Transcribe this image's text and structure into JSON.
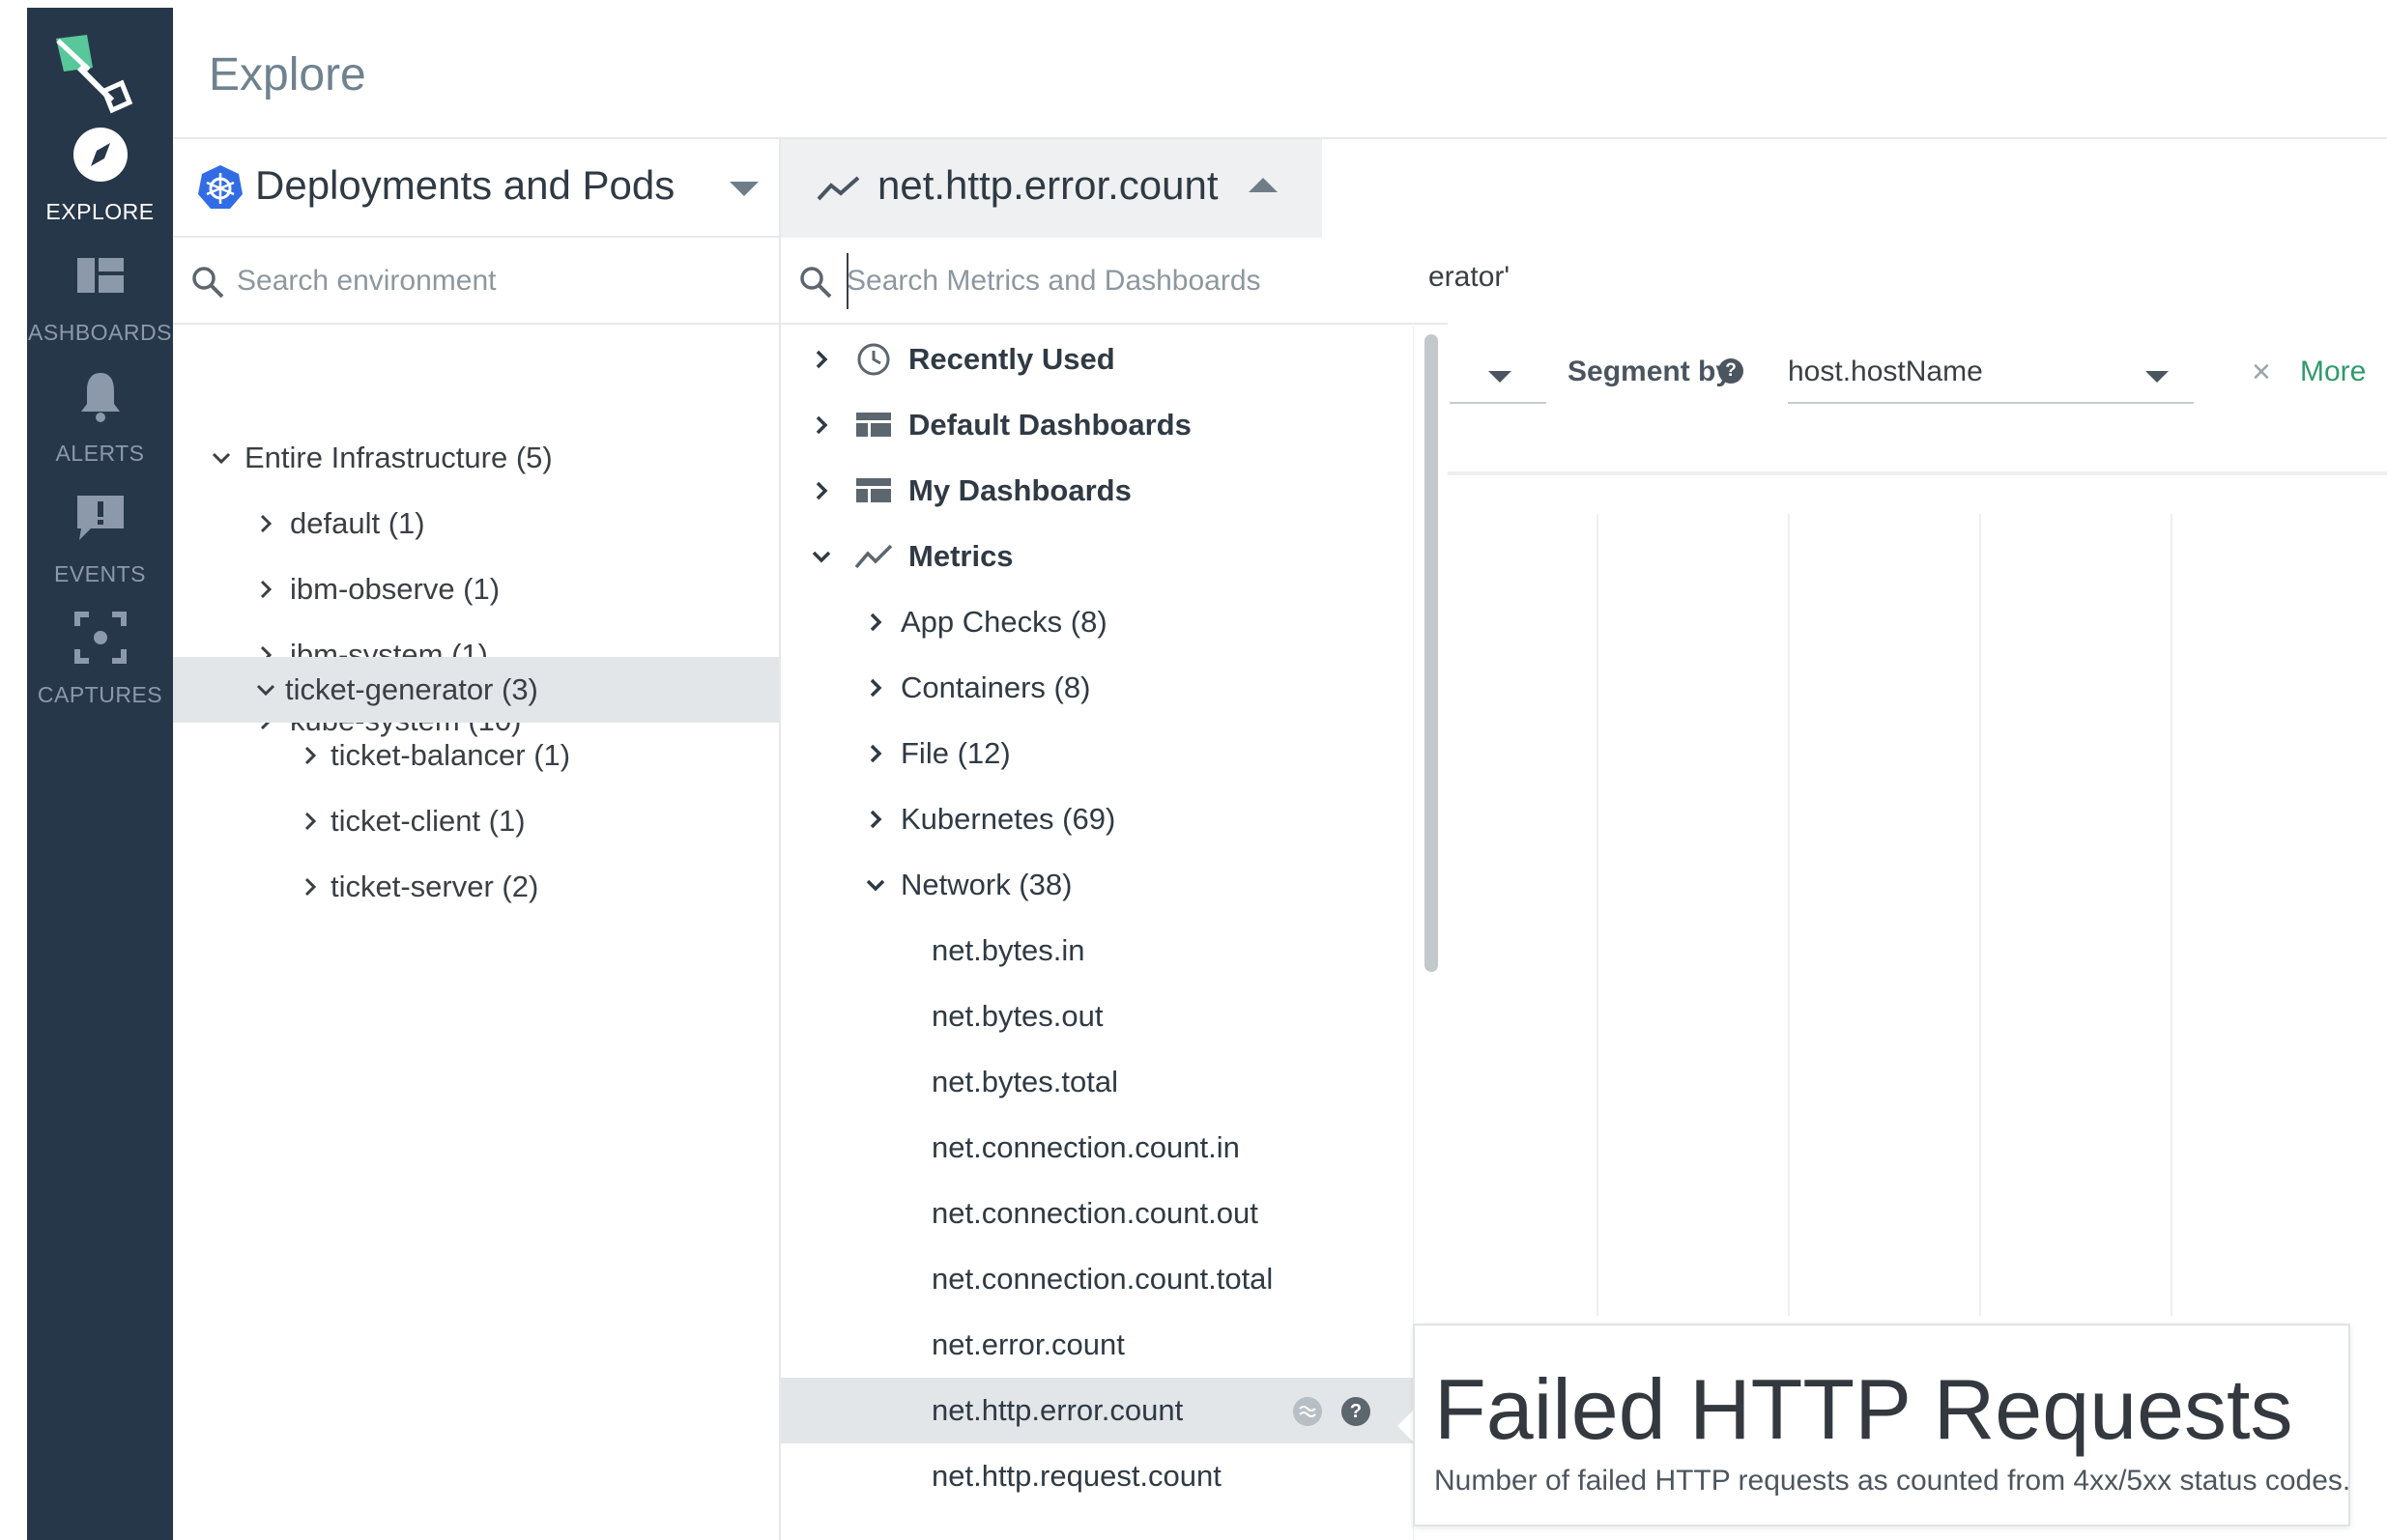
{
  "nav": {
    "items": [
      {
        "label": "EXPLORE",
        "icon": "compass-icon",
        "active": true
      },
      {
        "label": "ASHBOARDS",
        "icon": "dashboards-icon",
        "active": false
      },
      {
        "label": "ALERTS",
        "icon": "bell-icon",
        "active": false
      },
      {
        "label": "EVENTS",
        "icon": "event-alert-icon",
        "active": false
      },
      {
        "label": "CAPTURES",
        "icon": "capture-icon",
        "active": false
      }
    ]
  },
  "header": {
    "title": "Explore"
  },
  "scope": {
    "title": "Deployments and Pods",
    "icon": "kubernetes-icon",
    "search_placeholder": "Search environment",
    "tree": [
      {
        "label": "Entire Infrastructure (5)",
        "level": 0,
        "expanded": true
      },
      {
        "label": "default (1)",
        "level": 1,
        "expanded": false
      },
      {
        "label": "ibm-observe (1)",
        "level": 1,
        "expanded": false
      },
      {
        "label": "ibm-system (1)",
        "level": 1,
        "expanded": false
      },
      {
        "label": "kube-system (10)",
        "level": 1,
        "expanded": false
      },
      {
        "label": "ticket-generator (3)",
        "level": 1,
        "expanded": true,
        "selected": true
      },
      {
        "label": "ticket-balancer (1)",
        "level": 2,
        "expanded": false
      },
      {
        "label": "ticket-client (1)",
        "level": 2,
        "expanded": false
      },
      {
        "label": "ticket-server (2)",
        "level": 2,
        "expanded": false
      }
    ]
  },
  "metric": {
    "title": "net.http.error.count",
    "search_placeholder": "Search Metrics and Dashboards",
    "list": {
      "categories": [
        {
          "label": "Recently Used",
          "icon": "clock-icon",
          "expanded": false
        },
        {
          "label": "Default Dashboards",
          "icon": "dashboard-icon",
          "expanded": false
        },
        {
          "label": "My Dashboards",
          "icon": "dashboard-icon",
          "expanded": false
        },
        {
          "label": "Metrics",
          "icon": "line-chart-icon",
          "expanded": true
        }
      ],
      "groups": [
        {
          "label": "App Checks (8)",
          "expanded": false
        },
        {
          "label": "Containers (8)",
          "expanded": false
        },
        {
          "label": "File (12)",
          "expanded": false
        },
        {
          "label": "Kubernetes (69)",
          "expanded": false
        },
        {
          "label": "Network (38)",
          "expanded": true
        }
      ],
      "metrics": [
        {
          "label": "net.bytes.in"
        },
        {
          "label": "net.bytes.out"
        },
        {
          "label": "net.bytes.total"
        },
        {
          "label": "net.connection.count.in"
        },
        {
          "label": "net.connection.count.out"
        },
        {
          "label": "net.connection.count.total"
        },
        {
          "label": "net.error.count"
        },
        {
          "label": "net.http.error.count",
          "highlighted": true
        },
        {
          "label": "net.http.request.count"
        }
      ]
    }
  },
  "behind": {
    "partial_text": "erator'",
    "segment_label": "Segment by",
    "segment_value": "host.hostName",
    "close_glyph": "×",
    "more_label": "More"
  },
  "tooltip": {
    "title": "Failed HTTP Requests",
    "description": "Number of failed HTTP requests as counted from 4xx/5xx status codes."
  },
  "colors": {
    "rail": "#27374a",
    "accent_green": "#2f9a6b",
    "highlight_row": "#e3e6e9",
    "kubernetes_blue": "#326ce5"
  }
}
